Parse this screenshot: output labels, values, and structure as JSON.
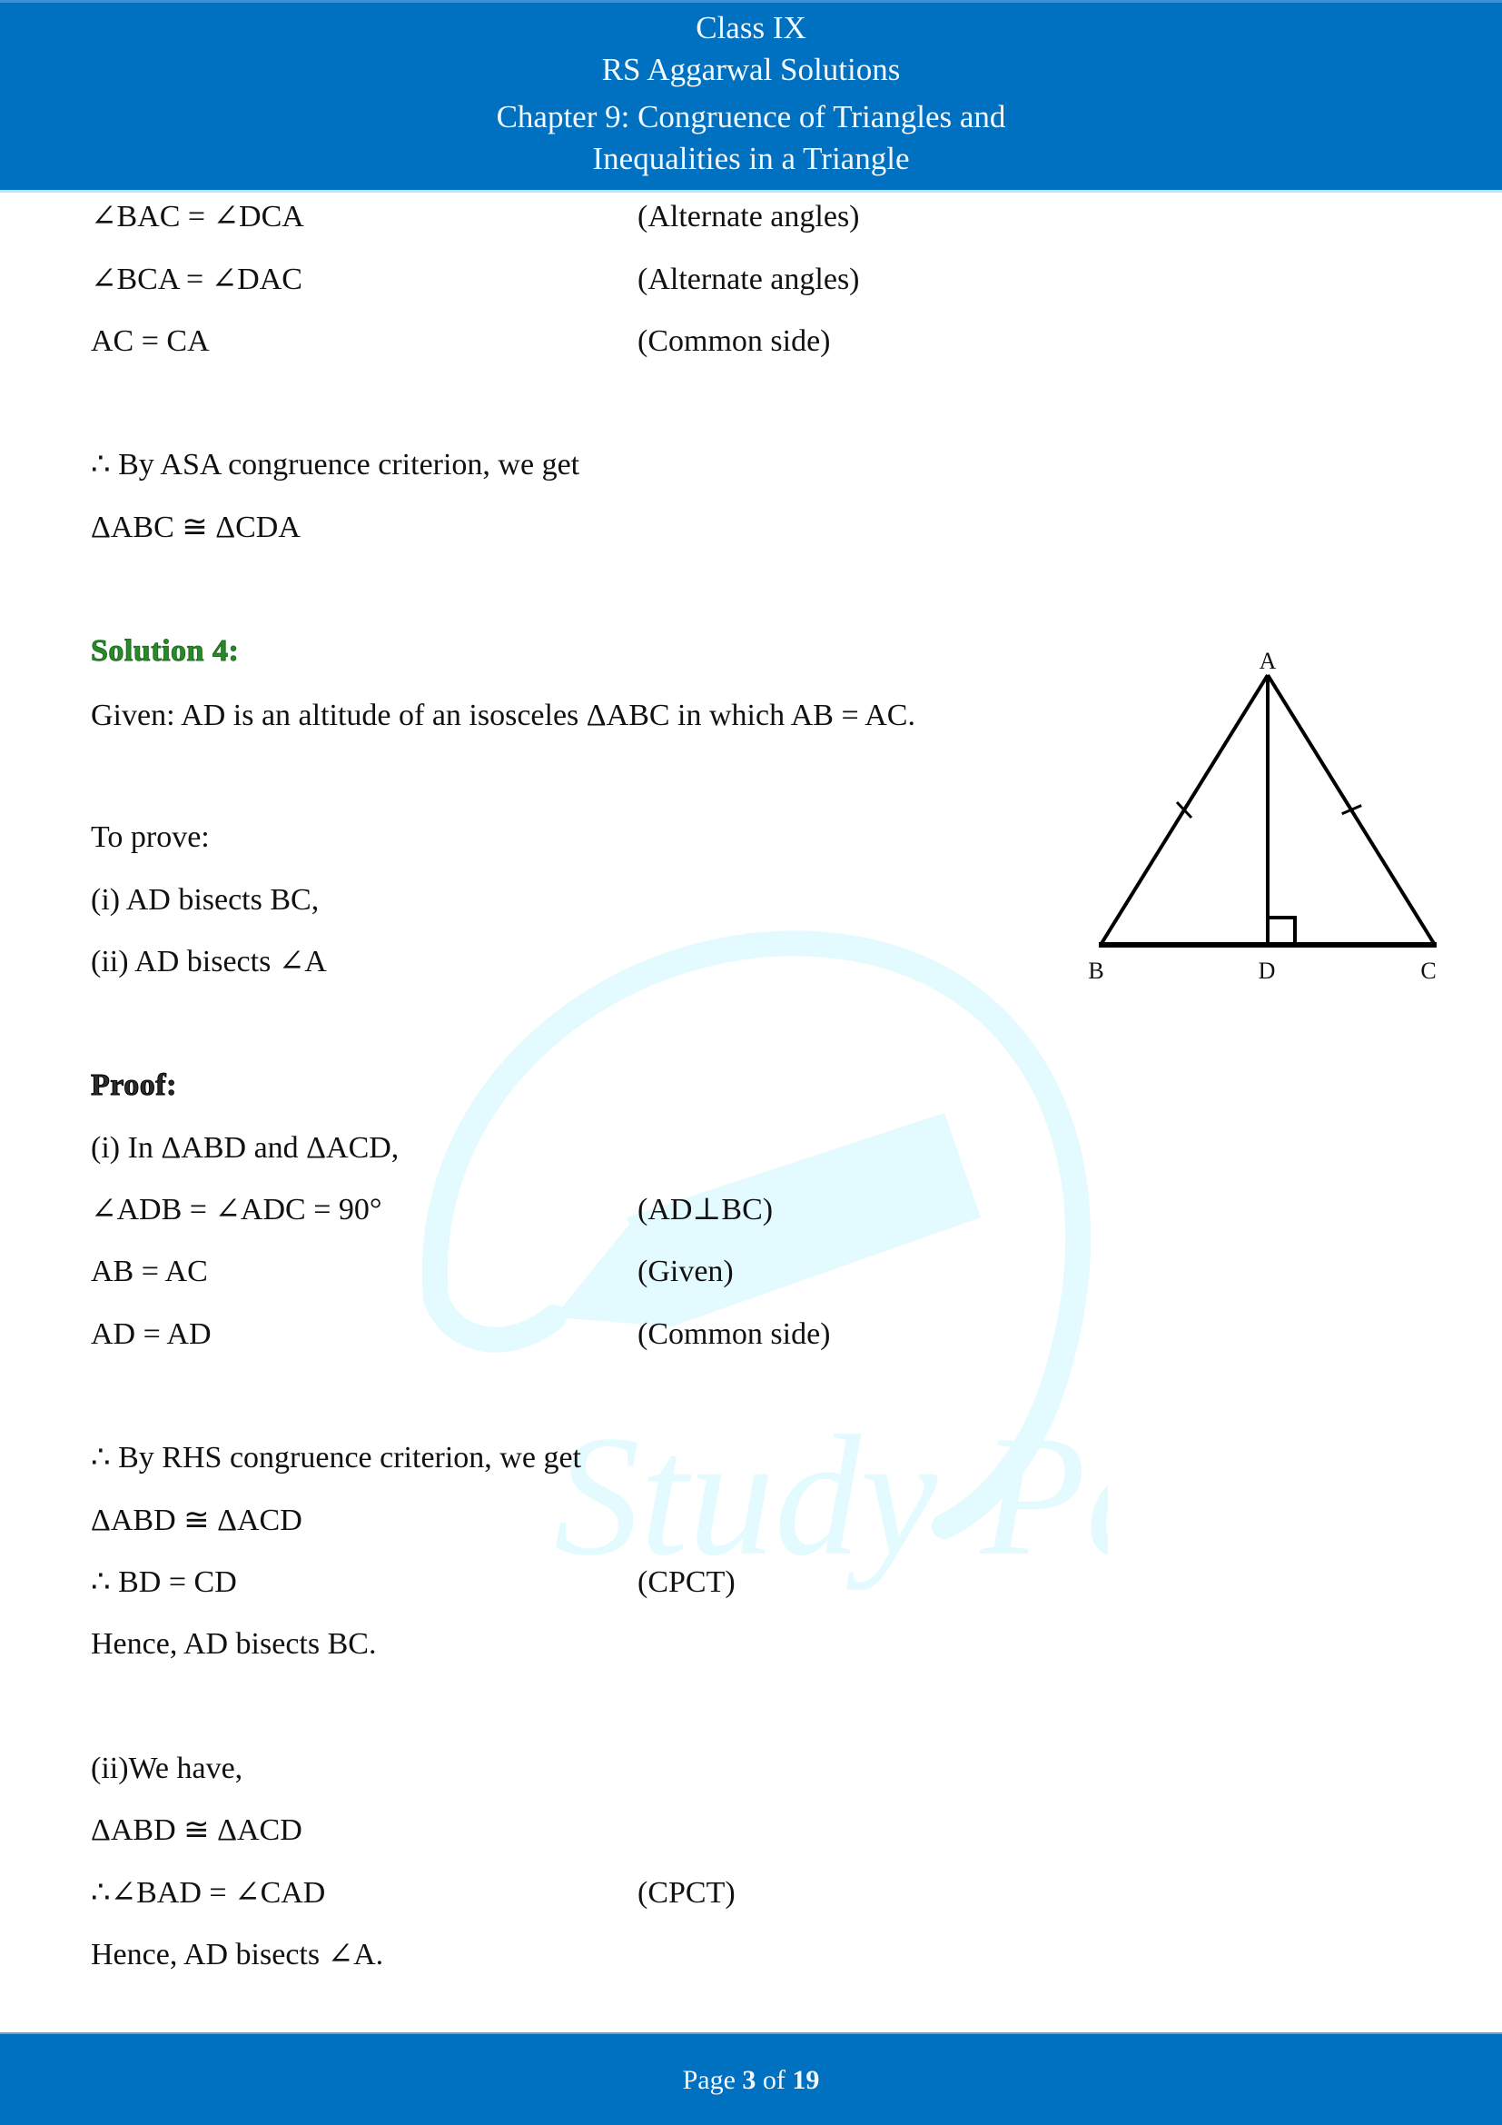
{
  "header": {
    "line1": "Class IX",
    "line2": "RS Aggarwal Solutions",
    "line3": "Chapter 9: Congruence of Triangles and",
    "line4": "Inequalities in a Triangle"
  },
  "watermark": {
    "text": "Study Path",
    "icon": "pen-logo-icon"
  },
  "content": {
    "prev": [
      {
        "left": "∠BAC = ∠DCA",
        "right": "(Alternate angles)"
      },
      {
        "left": "∠BCA = ∠DAC",
        "right": "(Alternate angles)"
      },
      {
        "left": "AC = CA",
        "right": "(Common side)"
      }
    ],
    "prev_conclusion": "∴ By ASA congruence criterion, we get",
    "prev_result": "ΔABC ≅ ΔCDA",
    "solution_heading": "Solution 4:",
    "given": "Given: AD is an altitude of an isosceles ΔABC in which AB = AC.",
    "to_prove_label": "To prove:",
    "to_prove": [
      "(i) AD bisects BC,",
      "(ii) AD bisects ∠A"
    ],
    "proof_heading": "Proof:",
    "part1_intro": "(i) In ΔABD and ΔACD,",
    "part1_steps": [
      {
        "left": "∠ADB = ∠ADC = 90°",
        "right": "(AD⊥BC)"
      },
      {
        "left": "AB = AC",
        "right": "(Given)"
      },
      {
        "left": "AD = AD",
        "right": "(Common side)"
      }
    ],
    "part1_conclusion": "∴ By RHS congruence criterion, we get",
    "part1_result": "ΔABD ≅ ΔACD",
    "part1_cpct": {
      "left": "∴ BD = CD",
      "right": "(CPCT)"
    },
    "part1_hence": "Hence, AD bisects BC.",
    "part2_intro": "(ii)We have,",
    "part2_result": "ΔABD ≅ ΔACD",
    "part2_cpct": {
      "left": "∴∠BAD = ∠CAD",
      "right": "(CPCT)"
    },
    "part2_hence": "Hence, AD bisects ∠A."
  },
  "figure": {
    "labels": {
      "A": "A",
      "B": "B",
      "C": "C",
      "D": "D"
    },
    "equal_sides": [
      "AB",
      "AC"
    ],
    "right_angle_at": "D"
  },
  "footer": {
    "prefix": "Page",
    "current": "3",
    "separator": "of",
    "total": "19"
  }
}
